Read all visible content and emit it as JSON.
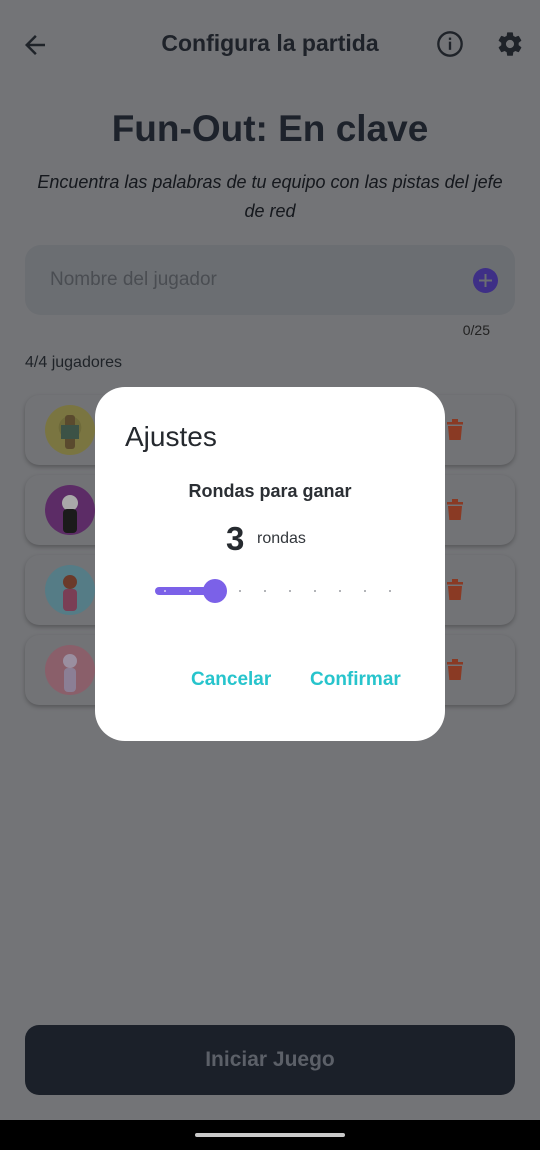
{
  "header": {
    "title": "Configura la partida",
    "back_icon": "arrow-left-icon",
    "info_icon": "info-icon",
    "settings_icon": "gear-icon"
  },
  "game": {
    "title": "Fun-Out: En clave",
    "subtitle": "Encuentra las palabras de tu equipo con las pistas del jefe de red"
  },
  "player_input": {
    "placeholder": "Nombre del jugador",
    "add_icon": "add-circle-icon",
    "char_counter": "0/25"
  },
  "players": {
    "count_label": "4/4 jugadores",
    "items": [
      {
        "avatar": "avatar-1",
        "delete_icon": "trash-icon"
      },
      {
        "avatar": "avatar-2",
        "delete_icon": "trash-icon"
      },
      {
        "avatar": "avatar-3",
        "delete_icon": "trash-icon"
      },
      {
        "avatar": "avatar-4",
        "delete_icon": "trash-icon"
      }
    ]
  },
  "start_button": {
    "label": "Iniciar Juego"
  },
  "dialog": {
    "title": "Ajustes",
    "rounds_label": "Rondas para ganar",
    "rounds_value": "3",
    "rounds_unit": "rondas",
    "slider": {
      "value": 3,
      "min": 1,
      "max": 10
    },
    "cancel_label": "Cancelar",
    "confirm_label": "Confirmar"
  },
  "colors": {
    "accent": "#7b61e8",
    "dialog_buttons": "#27c4cc",
    "delete": "#b5492c",
    "overlay_bg": "#737477"
  }
}
